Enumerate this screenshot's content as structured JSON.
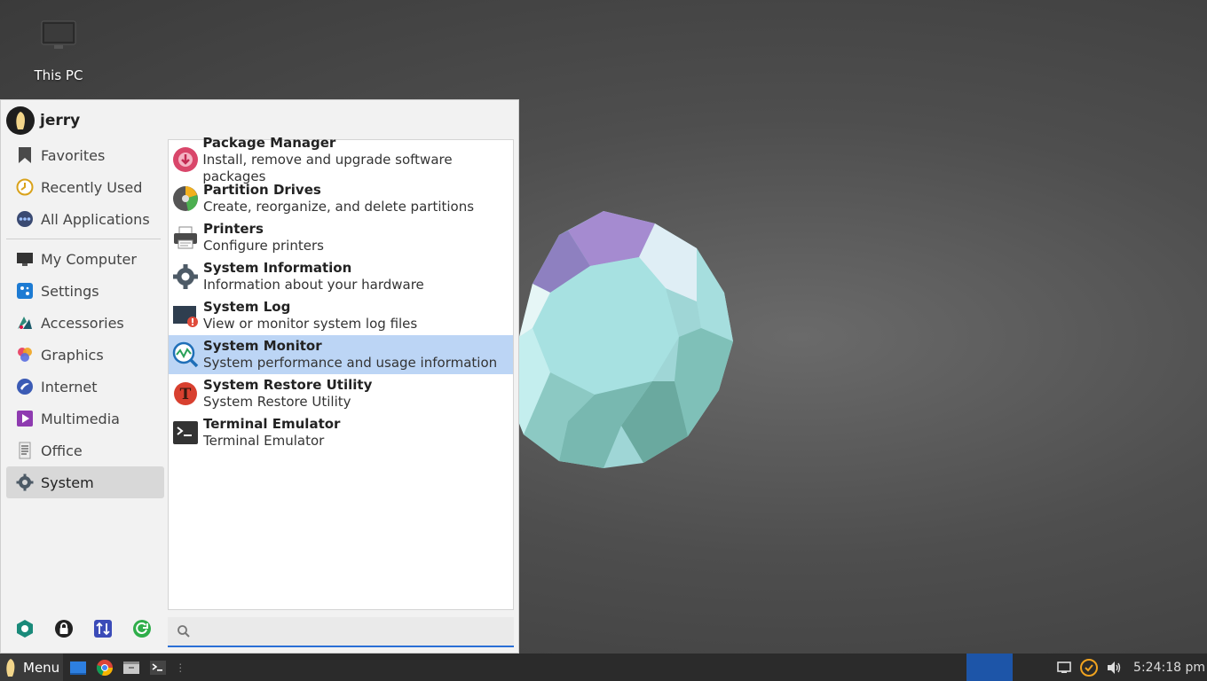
{
  "desktop": {
    "icons": [
      {
        "label": "This PC",
        "icon": "computer-icon"
      }
    ]
  },
  "menu": {
    "username": "jerry",
    "categories": [
      {
        "label": "Favorites",
        "icon": "bookmark-icon"
      },
      {
        "label": "Recently Used",
        "icon": "clock-icon"
      },
      {
        "label": "All Applications",
        "icon": "apps-icon"
      }
    ],
    "groups": [
      {
        "label": "My Computer",
        "icon": "monitor-icon"
      },
      {
        "label": "Settings",
        "icon": "settings-icon"
      },
      {
        "label": "Accessories",
        "icon": "accessories-icon"
      },
      {
        "label": "Graphics",
        "icon": "graphics-icon"
      },
      {
        "label": "Internet",
        "icon": "internet-icon"
      },
      {
        "label": "Multimedia",
        "icon": "multimedia-icon"
      },
      {
        "label": "Office",
        "icon": "office-icon"
      },
      {
        "label": "System",
        "icon": "gear-icon",
        "selected": true
      }
    ],
    "apps": [
      {
        "name": "Package Manager",
        "desc": "Install, remove and upgrade software packages",
        "icon": "package-icon"
      },
      {
        "name": "Partition Drives",
        "desc": "Create, reorganize, and delete partitions",
        "icon": "disk-icon"
      },
      {
        "name": "Printers",
        "desc": "Configure printers",
        "icon": "printer-icon"
      },
      {
        "name": "System Information",
        "desc": "Information about your hardware",
        "icon": "gear-icon"
      },
      {
        "name": "System Log",
        "desc": "View or monitor system log files",
        "icon": "log-icon"
      },
      {
        "name": "System Monitor",
        "desc": "System performance and usage information",
        "icon": "monitor-graph-icon",
        "selected": true
      },
      {
        "name": "System Restore Utility",
        "desc": "System Restore Utility",
        "icon": "restore-icon"
      },
      {
        "name": "Terminal Emulator",
        "desc": "Terminal Emulator",
        "icon": "terminal-icon"
      }
    ],
    "actions": [
      "software-center-icon",
      "lock-icon",
      "switch-user-icon",
      "logout-icon"
    ],
    "search": {
      "placeholder": "",
      "value": ""
    }
  },
  "taskbar": {
    "menu_label": "Menu",
    "launchers": [
      "show-desktop-icon",
      "chrome-icon",
      "files-icon",
      "terminal-icon"
    ],
    "tray": [
      "display-icon",
      "update-icon",
      "volume-icon"
    ],
    "clock": "5:24:18 pm"
  },
  "colors": {
    "accent": "#2a6fd6",
    "selection": "#bcd5f5",
    "workspace": "#1d55a8"
  }
}
